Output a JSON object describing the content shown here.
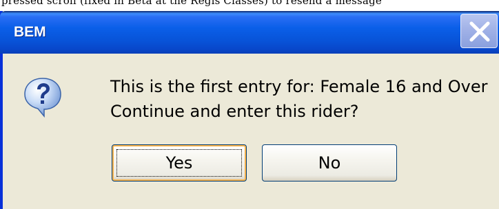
{
  "background_text": "pressed scroll (fixed in Beta at the Regis Classes) to resend a message",
  "window": {
    "title": "BEM",
    "close_icon": "close-icon"
  },
  "message": {
    "icon": "question-icon",
    "line1": "This is the first entry for: Female 16 and Over",
    "line2": "Continue and enter this rider?"
  },
  "buttons": {
    "yes_label": "Yes",
    "no_label": "No",
    "default": "yes"
  },
  "colors": {
    "title_bar": "#0a5fe8",
    "dialog_face": "#ece9d8",
    "close_button": "#9fb0e6",
    "default_button_highlight": "#f8b34c"
  }
}
